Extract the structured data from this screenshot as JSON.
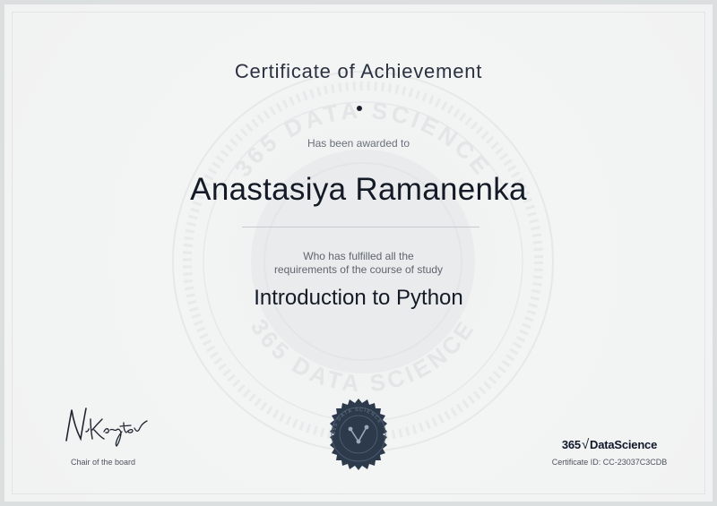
{
  "certificate": {
    "title": "Certificate of Achievement",
    "awarded_text": "Has been awarded to",
    "recipient_name": "Anastasiya Ramanenka",
    "fulfilled_line1": "Who has fulfilled all the",
    "fulfilled_line2": "requirements of the course of study",
    "course_name": "Introduction to Python",
    "signer_role": "Chair of the board",
    "signature_text": "N.Krastev",
    "brand_prefix": "365",
    "brand_sqrt": "√",
    "brand_name": "DataScience",
    "certificate_id": "Certificate ID: CC-23037C3CDB",
    "watermark_text": "365 DATA SCIENCE"
  },
  "colors": {
    "text_dark": "#141a26",
    "text_muted": "#6a707a",
    "seal_fill": "#2c3a4c",
    "background": "#f1f2f2"
  },
  "icons": {
    "seal": "seal-icon",
    "signature": "signature-icon",
    "watermark": "watermark-seal-icon"
  }
}
